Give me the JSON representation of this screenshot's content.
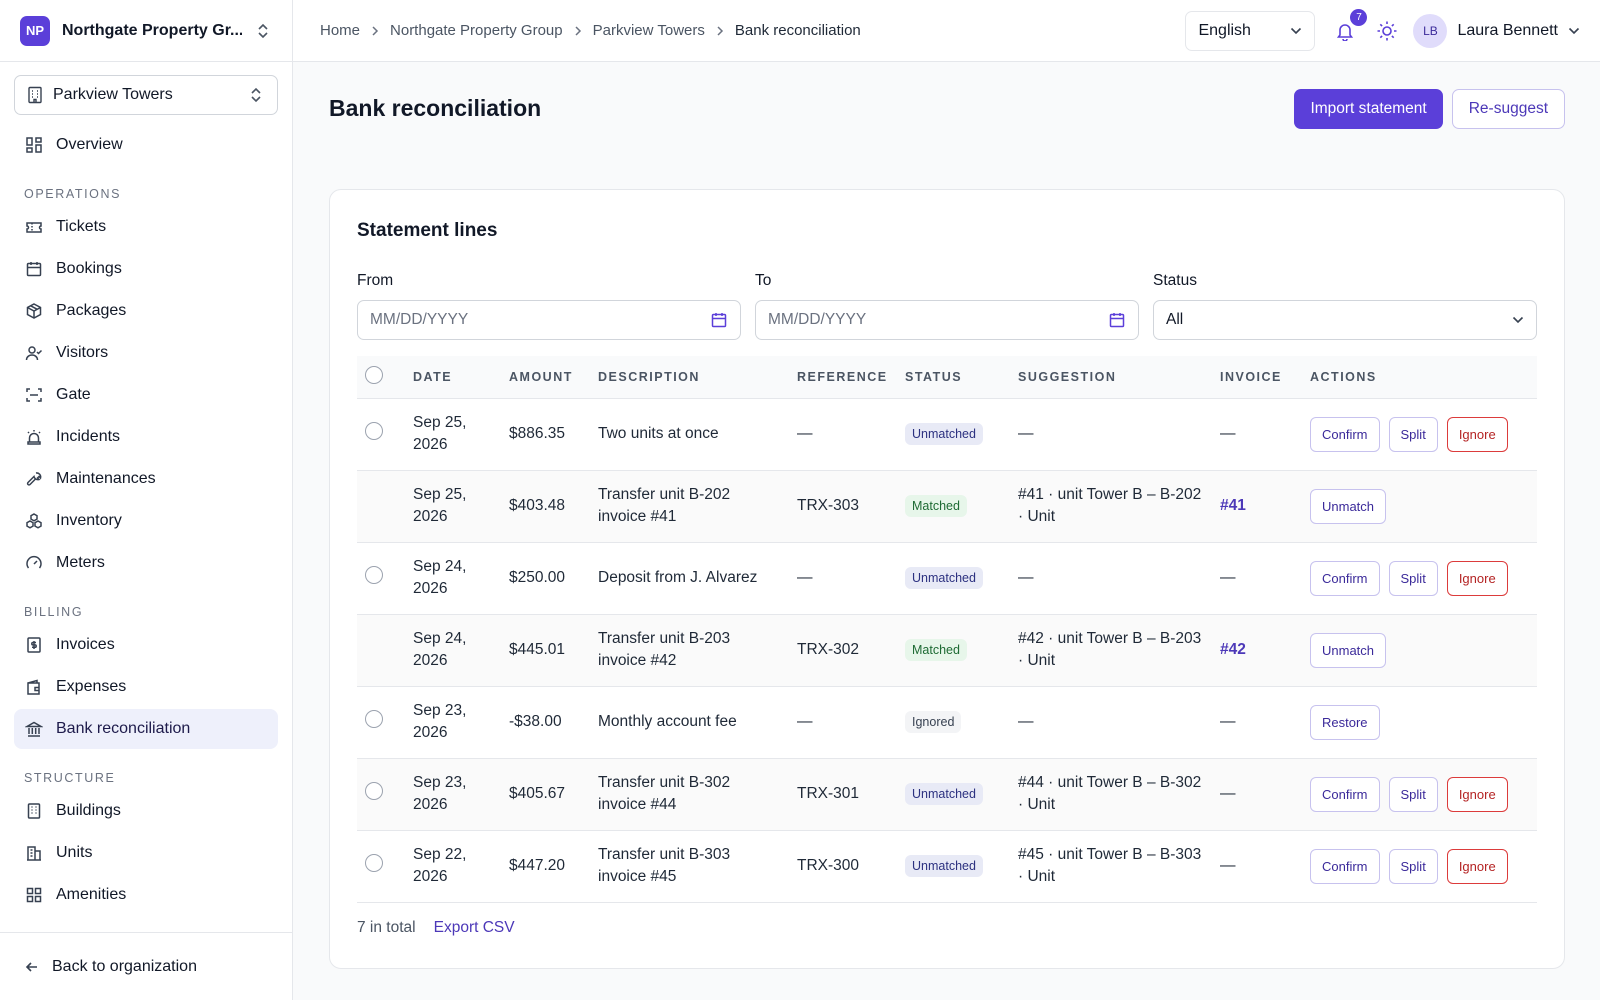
{
  "org": {
    "initials": "NP",
    "name": "Northgate Property Gr..."
  },
  "building": {
    "name": "Parkview Towers"
  },
  "nav": {
    "overview": "Overview",
    "sections": {
      "operations": "OPERATIONS",
      "billing": "BILLING",
      "structure": "STRUCTURE"
    },
    "operations": [
      "Tickets",
      "Bookings",
      "Packages",
      "Visitors",
      "Gate",
      "Incidents",
      "Maintenances",
      "Inventory",
      "Meters"
    ],
    "billing": [
      "Invoices",
      "Expenses",
      "Bank reconciliation"
    ],
    "structure": [
      "Buildings",
      "Units",
      "Amenities"
    ],
    "back": "Back to organization"
  },
  "breadcrumb": [
    "Home",
    "Northgate Property Group",
    "Parkview Towers",
    "Bank reconciliation"
  ],
  "topbar": {
    "language": "English",
    "notifications": "7",
    "user_initials": "LB",
    "user_name": "Laura Bennett"
  },
  "page": {
    "title": "Bank reconciliation",
    "import_label": "Import statement",
    "resuggest_label": "Re-suggest"
  },
  "card": {
    "title": "Statement lines",
    "filters": {
      "from_label": "From",
      "from_placeholder": "MM/DD/YYYY",
      "to_label": "To",
      "to_placeholder": "MM/DD/YYYY",
      "status_label": "Status",
      "status_value": "All"
    },
    "columns": [
      "DATE",
      "AMOUNT",
      "DESCRIPTION",
      "REFERENCE",
      "STATUS",
      "SUGGESTION",
      "INVOICE",
      "ACTIONS"
    ],
    "rows": [
      {
        "date": "Sep 25, 2026",
        "amount": "$886.35",
        "description": "Two units at once",
        "reference": "—",
        "status": "Unmatched",
        "suggestion": "—",
        "invoice": "—",
        "actions": [
          "Confirm",
          "Split",
          "Ignore"
        ],
        "checkbox": true
      },
      {
        "date": "Sep 25, 2026",
        "amount": "$403.48",
        "description": "Transfer unit B-202 invoice #41",
        "reference": "TRX-303",
        "status": "Matched",
        "suggestion": "#41 · unit Tower B – B-202 · Unit",
        "invoice": "#41",
        "actions": [
          "Unmatch"
        ],
        "checkbox": false
      },
      {
        "date": "Sep 24, 2026",
        "amount": "$250.00",
        "description": "Deposit from J. Alvarez",
        "reference": "—",
        "status": "Unmatched",
        "suggestion": "—",
        "invoice": "—",
        "actions": [
          "Confirm",
          "Split",
          "Ignore"
        ],
        "checkbox": true
      },
      {
        "date": "Sep 24, 2026",
        "amount": "$445.01",
        "description": "Transfer unit B-203 invoice #42",
        "reference": "TRX-302",
        "status": "Matched",
        "suggestion": "#42 · unit Tower B – B-203 · Unit",
        "invoice": "#42",
        "actions": [
          "Unmatch"
        ],
        "checkbox": false
      },
      {
        "date": "Sep 23, 2026",
        "amount": "-$38.00",
        "description": "Monthly account fee",
        "reference": "—",
        "status": "Ignored",
        "suggestion": "—",
        "invoice": "—",
        "actions": [
          "Restore"
        ],
        "checkbox": true
      },
      {
        "date": "Sep 23, 2026",
        "amount": "$405.67",
        "description": "Transfer unit B-302 invoice #44",
        "reference": "TRX-301",
        "status": "Unmatched",
        "suggestion": "#44 · unit Tower B – B-302 · Unit",
        "invoice": "—",
        "actions": [
          "Confirm",
          "Split",
          "Ignore"
        ],
        "checkbox": true
      },
      {
        "date": "Sep 22, 2026",
        "amount": "$447.20",
        "description": "Transfer unit B-303 invoice #45",
        "reference": "TRX-300",
        "status": "Unmatched",
        "suggestion": "#45 · unit Tower B – B-303 · Unit",
        "invoice": "—",
        "actions": [
          "Confirm",
          "Split",
          "Ignore"
        ],
        "checkbox": true
      }
    ],
    "total": "7 in total",
    "export": "Export CSV"
  },
  "colors": {
    "accent": "#5b3fd9",
    "danger": "#dc3b3b",
    "matched": "#1e6b34"
  }
}
